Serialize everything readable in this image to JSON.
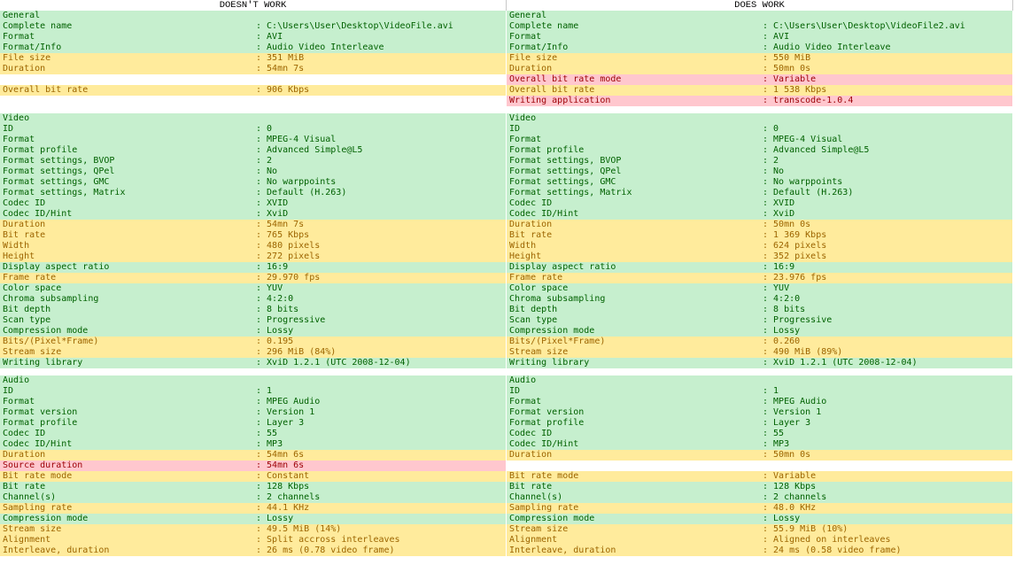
{
  "header": {
    "left": "DOESN'T WORK",
    "right": "DOES WORK"
  },
  "colors": {
    "match": "#c6efce",
    "differ": "#ffeb9c",
    "missing": "#ffc7ce"
  },
  "rows": [
    {
      "t": "g",
      "L": [
        "General",
        ""
      ],
      "R": [
        "General",
        ""
      ]
    },
    {
      "t": "g",
      "L": [
        "Complete name",
        ": C:\\Users\\User\\Desktop\\VideoFile.avi"
      ],
      "R": [
        "Complete name",
        ": C:\\Users\\User\\Desktop\\VideoFile2.avi"
      ]
    },
    {
      "t": "g",
      "L": [
        "Format",
        ": AVI"
      ],
      "R": [
        "Format",
        ": AVI"
      ]
    },
    {
      "t": "g",
      "L": [
        "Format/Info",
        ": Audio Video Interleave"
      ],
      "R": [
        "Format/Info",
        ": Audio Video Interleave"
      ]
    },
    {
      "t": "y",
      "L": [
        "File size",
        ": 351 MiB"
      ],
      "R": [
        "File size",
        ": 550 MiB"
      ]
    },
    {
      "t": "y",
      "L": [
        "Duration",
        ": 54mn 7s"
      ],
      "R": [
        "Duration",
        ": 50mn 0s"
      ]
    },
    {
      "t": "p",
      "L": [
        "",
        ""
      ],
      "R": [
        "Overall bit rate mode",
        ": Variable"
      ]
    },
    {
      "t": "y",
      "L": [
        "Overall bit rate",
        ": 906 Kbps"
      ],
      "R": [
        "Overall bit rate",
        ": 1 538 Kbps"
      ]
    },
    {
      "t": "p",
      "L": [
        "",
        ""
      ],
      "R": [
        "Writing application",
        ": transcode-1.0.4"
      ]
    },
    {
      "t": "blank"
    },
    {
      "t": "g",
      "L": [
        "Video",
        ""
      ],
      "R": [
        "Video",
        ""
      ]
    },
    {
      "t": "g",
      "L": [
        "ID",
        ": 0"
      ],
      "R": [
        "ID",
        ": 0"
      ]
    },
    {
      "t": "g",
      "L": [
        "Format",
        ": MPEG-4 Visual"
      ],
      "R": [
        "Format",
        ": MPEG-4 Visual"
      ]
    },
    {
      "t": "g",
      "L": [
        "Format profile",
        ": Advanced Simple@L5"
      ],
      "R": [
        "Format profile",
        ": Advanced Simple@L5"
      ]
    },
    {
      "t": "g",
      "L": [
        "Format settings, BVOP",
        ": 2"
      ],
      "R": [
        "Format settings, BVOP",
        ": 2"
      ]
    },
    {
      "t": "g",
      "L": [
        "Format settings, QPel",
        ": No"
      ],
      "R": [
        "Format settings, QPel",
        ": No"
      ]
    },
    {
      "t": "g",
      "L": [
        "Format settings, GMC",
        ": No warppoints"
      ],
      "R": [
        "Format settings, GMC",
        ": No warppoints"
      ]
    },
    {
      "t": "g",
      "L": [
        "Format settings, Matrix",
        ": Default (H.263)"
      ],
      "R": [
        "Format settings, Matrix",
        ": Default (H.263)"
      ]
    },
    {
      "t": "g",
      "L": [
        "Codec ID",
        ": XVID"
      ],
      "R": [
        "Codec ID",
        ": XVID"
      ]
    },
    {
      "t": "g",
      "L": [
        "Codec ID/Hint",
        ": XviD"
      ],
      "R": [
        "Codec ID/Hint",
        ": XviD"
      ]
    },
    {
      "t": "y",
      "L": [
        "Duration",
        ": 54mn 7s"
      ],
      "R": [
        "Duration",
        ": 50mn 0s"
      ]
    },
    {
      "t": "y",
      "L": [
        "Bit rate",
        ": 765 Kbps"
      ],
      "R": [
        "Bit rate",
        ": 1 369 Kbps"
      ]
    },
    {
      "t": "y",
      "L": [
        "Width",
        ": 480 pixels"
      ],
      "R": [
        "Width",
        ": 624 pixels"
      ]
    },
    {
      "t": "y",
      "L": [
        "Height",
        ": 272 pixels"
      ],
      "R": [
        "Height",
        ": 352 pixels"
      ]
    },
    {
      "t": "g",
      "L": [
        "Display aspect ratio",
        ": 16:9"
      ],
      "R": [
        "Display aspect ratio",
        ": 16:9"
      ]
    },
    {
      "t": "y",
      "L": [
        "Frame rate",
        ": 29.970 fps"
      ],
      "R": [
        "Frame rate",
        ": 23.976 fps"
      ]
    },
    {
      "t": "g",
      "L": [
        "Color space",
        ": YUV"
      ],
      "R": [
        "Color space",
        ": YUV"
      ]
    },
    {
      "t": "g",
      "L": [
        "Chroma subsampling",
        ": 4:2:0"
      ],
      "R": [
        "Chroma subsampling",
        ": 4:2:0"
      ]
    },
    {
      "t": "g",
      "L": [
        "Bit depth",
        ": 8 bits"
      ],
      "R": [
        "Bit depth",
        ": 8 bits"
      ]
    },
    {
      "t": "g",
      "L": [
        "Scan type",
        ": Progressive"
      ],
      "R": [
        "Scan type",
        ": Progressive"
      ]
    },
    {
      "t": "g",
      "L": [
        "Compression mode",
        ": Lossy"
      ],
      "R": [
        "Compression mode",
        ": Lossy"
      ]
    },
    {
      "t": "y",
      "L": [
        "Bits/(Pixel*Frame)",
        ": 0.195"
      ],
      "R": [
        "Bits/(Pixel*Frame)",
        ": 0.260"
      ]
    },
    {
      "t": "y",
      "L": [
        "Stream size",
        ": 296 MiB (84%)"
      ],
      "R": [
        "Stream size",
        ": 490 MiB (89%)"
      ]
    },
    {
      "t": "g",
      "L": [
        "Writing library",
        ": XviD 1.2.1 (UTC 2008-12-04)"
      ],
      "R": [
        "Writing library",
        ": XviD 1.2.1 (UTC 2008-12-04)"
      ]
    },
    {
      "t": "blank"
    },
    {
      "t": "g",
      "L": [
        "Audio",
        ""
      ],
      "R": [
        "Audio",
        ""
      ]
    },
    {
      "t": "g",
      "L": [
        "ID",
        ": 1"
      ],
      "R": [
        "ID",
        ": 1"
      ]
    },
    {
      "t": "g",
      "L": [
        "Format",
        ": MPEG Audio"
      ],
      "R": [
        "Format",
        ": MPEG Audio"
      ]
    },
    {
      "t": "g",
      "L": [
        "Format version",
        ": Version 1"
      ],
      "R": [
        "Format version",
        ": Version 1"
      ]
    },
    {
      "t": "g",
      "L": [
        "Format profile",
        ": Layer 3"
      ],
      "R": [
        "Format profile",
        ": Layer 3"
      ]
    },
    {
      "t": "g",
      "L": [
        "Codec ID",
        ": 55"
      ],
      "R": [
        "Codec ID",
        ": 55"
      ]
    },
    {
      "t": "g",
      "L": [
        "Codec ID/Hint",
        ": MP3"
      ],
      "R": [
        "Codec ID/Hint",
        ": MP3"
      ]
    },
    {
      "t": "y",
      "L": [
        "Duration",
        ": 54mn 6s"
      ],
      "R": [
        "Duration",
        ": 50mn 0s"
      ]
    },
    {
      "t": "p",
      "L": [
        "Source duration",
        ": 54mn 6s"
      ],
      "R": [
        "",
        ""
      ]
    },
    {
      "t": "y",
      "L": [
        "Bit rate mode",
        ": Constant"
      ],
      "R": [
        "Bit rate mode",
        ": Variable"
      ]
    },
    {
      "t": "g",
      "L": [
        "Bit rate",
        ": 128 Kbps"
      ],
      "R": [
        "Bit rate",
        ": 128 Kbps"
      ]
    },
    {
      "t": "g",
      "L": [
        "Channel(s)",
        ": 2 channels"
      ],
      "R": [
        "Channel(s)",
        ": 2 channels"
      ]
    },
    {
      "t": "y",
      "L": [
        "Sampling rate",
        ": 44.1 KHz"
      ],
      "R": [
        "Sampling rate",
        ": 48.0 KHz"
      ]
    },
    {
      "t": "g",
      "L": [
        "Compression mode",
        ": Lossy"
      ],
      "R": [
        "Compression mode",
        ": Lossy"
      ]
    },
    {
      "t": "y",
      "L": [
        "Stream size",
        ": 49.5 MiB (14%)"
      ],
      "R": [
        "Stream size",
        ": 55.9 MiB (10%)"
      ]
    },
    {
      "t": "y",
      "L": [
        "Alignment",
        ": Split accross interleaves"
      ],
      "R": [
        "Alignment",
        ": Aligned on interleaves"
      ]
    },
    {
      "t": "y",
      "L": [
        "Interleave, duration",
        ": 26 ms (0.78 video frame)"
      ],
      "R": [
        "Interleave, duration",
        ": 24 ms (0.58 video frame)"
      ]
    }
  ]
}
